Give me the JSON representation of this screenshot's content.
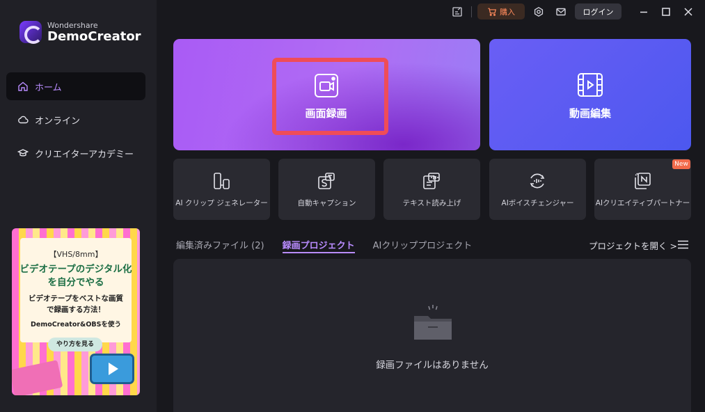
{
  "sidebar": {
    "logo": {
      "brand": "Wondershare",
      "product": "DemoCreator"
    },
    "items": [
      {
        "label": "ホーム",
        "icon": "home-icon",
        "active": true
      },
      {
        "label": "オンライン",
        "icon": "cloud-icon",
        "active": false
      },
      {
        "label": "クリエイターアカデミー",
        "icon": "graduation-cap-icon",
        "active": false
      }
    ],
    "promo": {
      "tag": "【VHS/8mm】",
      "title_line1": "ビデオテープのデジタル化",
      "title_line2": "を自分でやる",
      "sub_line1": "ビデオテープをベストな画質",
      "sub_line2": "で録画する方法！",
      "sub_line3": "DemoCreator&OBSを使う",
      "button": "やり方を見る"
    }
  },
  "topbar": {
    "buy_label": "購入",
    "login_label": "ログイン",
    "colors": {
      "buy_text": "#ff8a5c",
      "buy_bg": "#3b2a22"
    }
  },
  "main": {
    "record_card": {
      "label": "画面録画",
      "icon": "camera-record-icon"
    },
    "edit_card": {
      "label": "動画編集",
      "icon": "film-play-icon"
    },
    "tools": [
      {
        "label": "AI クリップ ジェネレーター",
        "icon": "ai-clip-icon"
      },
      {
        "label": "自動キャプション",
        "icon": "caption-icon"
      },
      {
        "label": "テキスト読み上げ",
        "icon": "text-to-speech-icon"
      },
      {
        "label": "AIボイスチェンジャー",
        "icon": "voice-changer-icon"
      },
      {
        "label": "AIクリエイティブパートナー",
        "icon": "ai-partner-icon",
        "badge": "New"
      }
    ],
    "tabs": [
      {
        "label": "編集済みファイル (2)",
        "active": false
      },
      {
        "label": "録画プロジェクト",
        "active": true
      },
      {
        "label": "AIクリッププロジェクト",
        "active": false
      }
    ],
    "open_project": "プロジェクトを開く >",
    "empty_message": "録画ファイルはありません"
  },
  "colors": {
    "accent": "#b98cff",
    "highlight": "#ef4c58"
  }
}
